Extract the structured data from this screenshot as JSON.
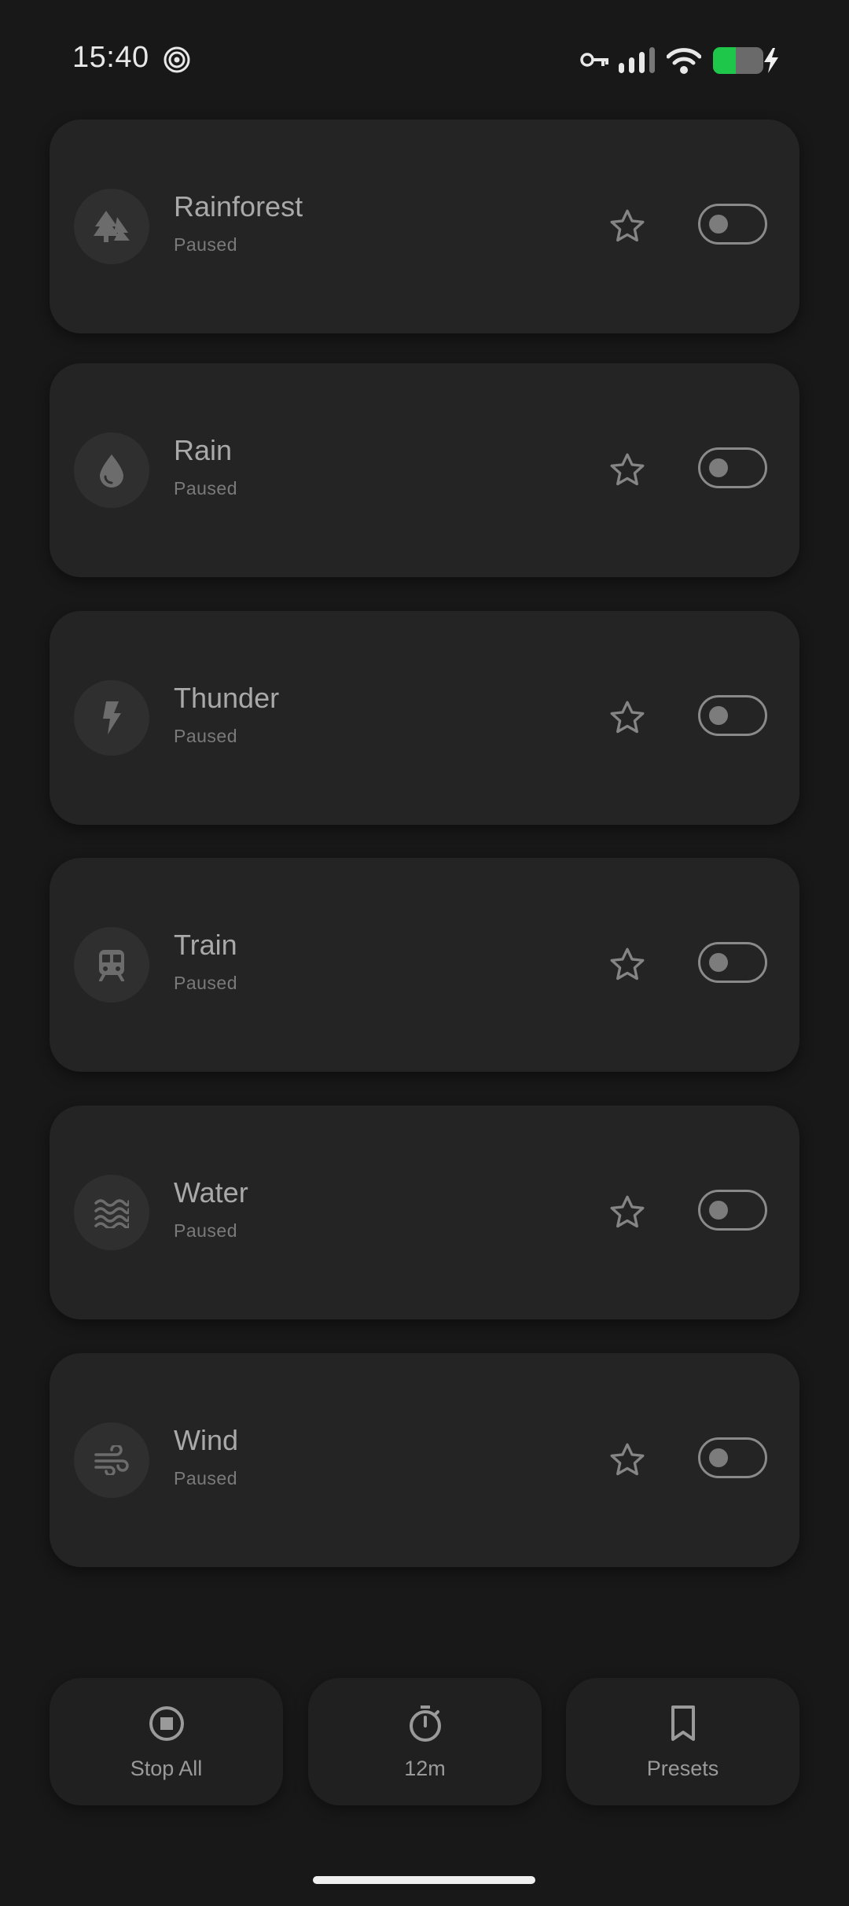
{
  "status_bar": {
    "time": "15:40",
    "icons": [
      "hotspot-icon",
      "vpn-key-icon",
      "signal-icon",
      "wifi-icon",
      "battery-charging-icon"
    ],
    "battery_color": "#1ec74a"
  },
  "sounds": [
    {
      "name": "Rainforest",
      "status": "Paused",
      "icon": "forest-icon",
      "favorite": false,
      "enabled": false
    },
    {
      "name": "Rain",
      "status": "Paused",
      "icon": "water-drop-icon",
      "favorite": false,
      "enabled": false
    },
    {
      "name": "Thunder",
      "status": "Paused",
      "icon": "lightning-icon",
      "favorite": false,
      "enabled": false
    },
    {
      "name": "Train",
      "status": "Paused",
      "icon": "train-icon",
      "favorite": false,
      "enabled": false
    },
    {
      "name": "Water",
      "status": "Paused",
      "icon": "waves-icon",
      "favorite": false,
      "enabled": false
    },
    {
      "name": "Wind",
      "status": "Paused",
      "icon": "wind-icon",
      "favorite": false,
      "enabled": false
    }
  ],
  "bottom_bar": {
    "stop_all": "Stop All",
    "timer": "12m",
    "presets": "Presets"
  }
}
